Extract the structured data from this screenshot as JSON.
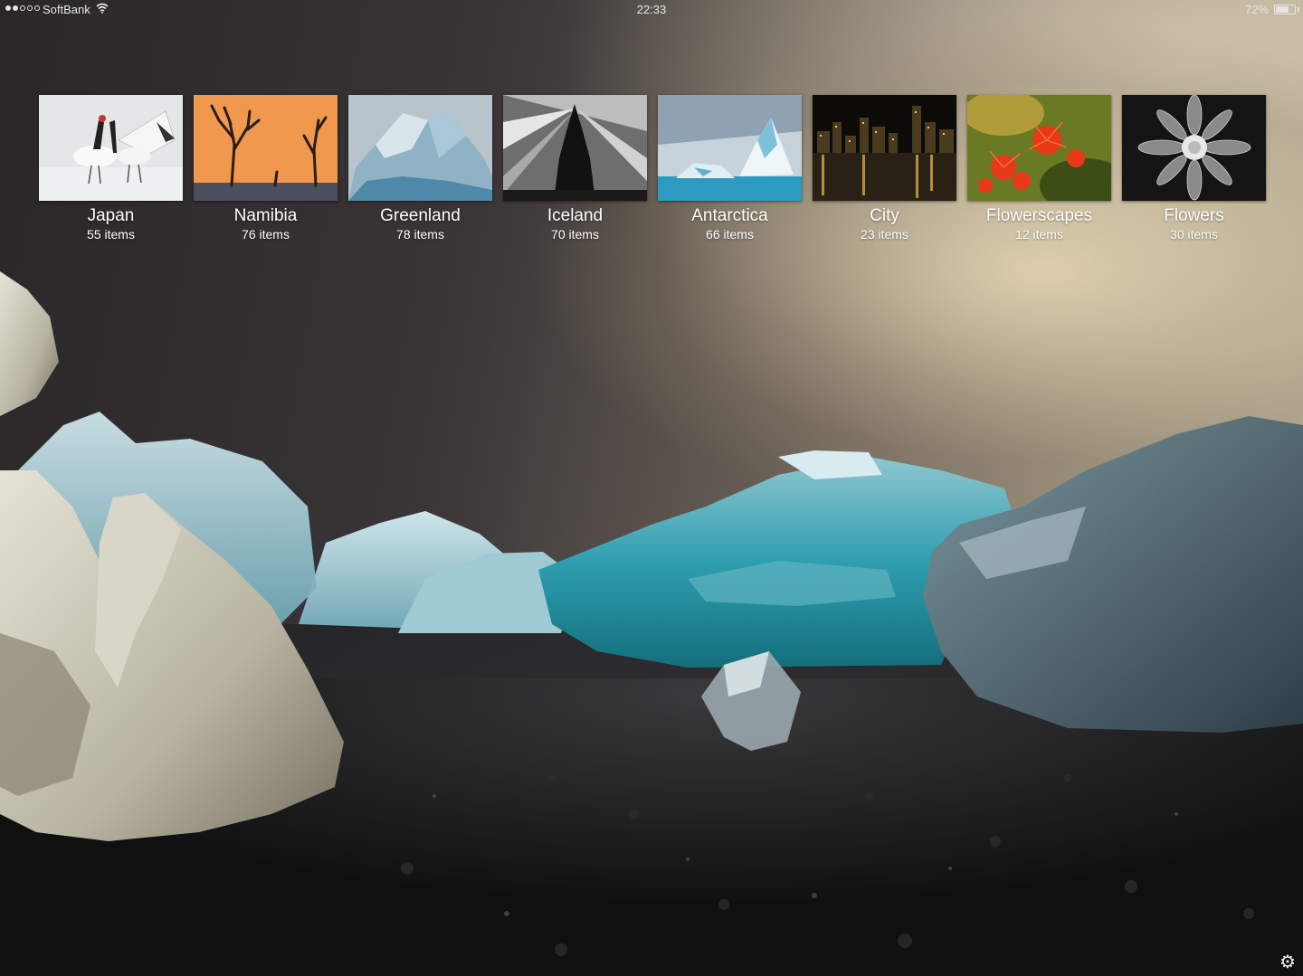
{
  "status_bar": {
    "carrier": "SoftBank",
    "signal_bars": 2,
    "signal_total": 5,
    "wifi_icon": "wifi-icon",
    "time": "22:33",
    "battery_percent_label": "72%",
    "battery_level": 0.72
  },
  "albums": [
    {
      "title": "Japan",
      "count": "55 items",
      "thumb": "cranes-in-snow"
    },
    {
      "title": "Namibia",
      "count": "76 items",
      "thumb": "dead-trees-orange-dune"
    },
    {
      "title": "Greenland",
      "count": "78 items",
      "thumb": "iceberg"
    },
    {
      "title": "Iceland",
      "count": "70 items",
      "thumb": "church-silhouette-bw"
    },
    {
      "title": "Antarctica",
      "count": "66 items",
      "thumb": "blue-iceberg"
    },
    {
      "title": "City",
      "count": "23 items",
      "thumb": "night-skyline"
    },
    {
      "title": "Flowerscapes",
      "count": "12 items",
      "thumb": "red-flowers"
    },
    {
      "title": "Flowers",
      "count": "30 items",
      "thumb": "bw-dahlia"
    }
  ],
  "settings_icon": "gear-icon"
}
